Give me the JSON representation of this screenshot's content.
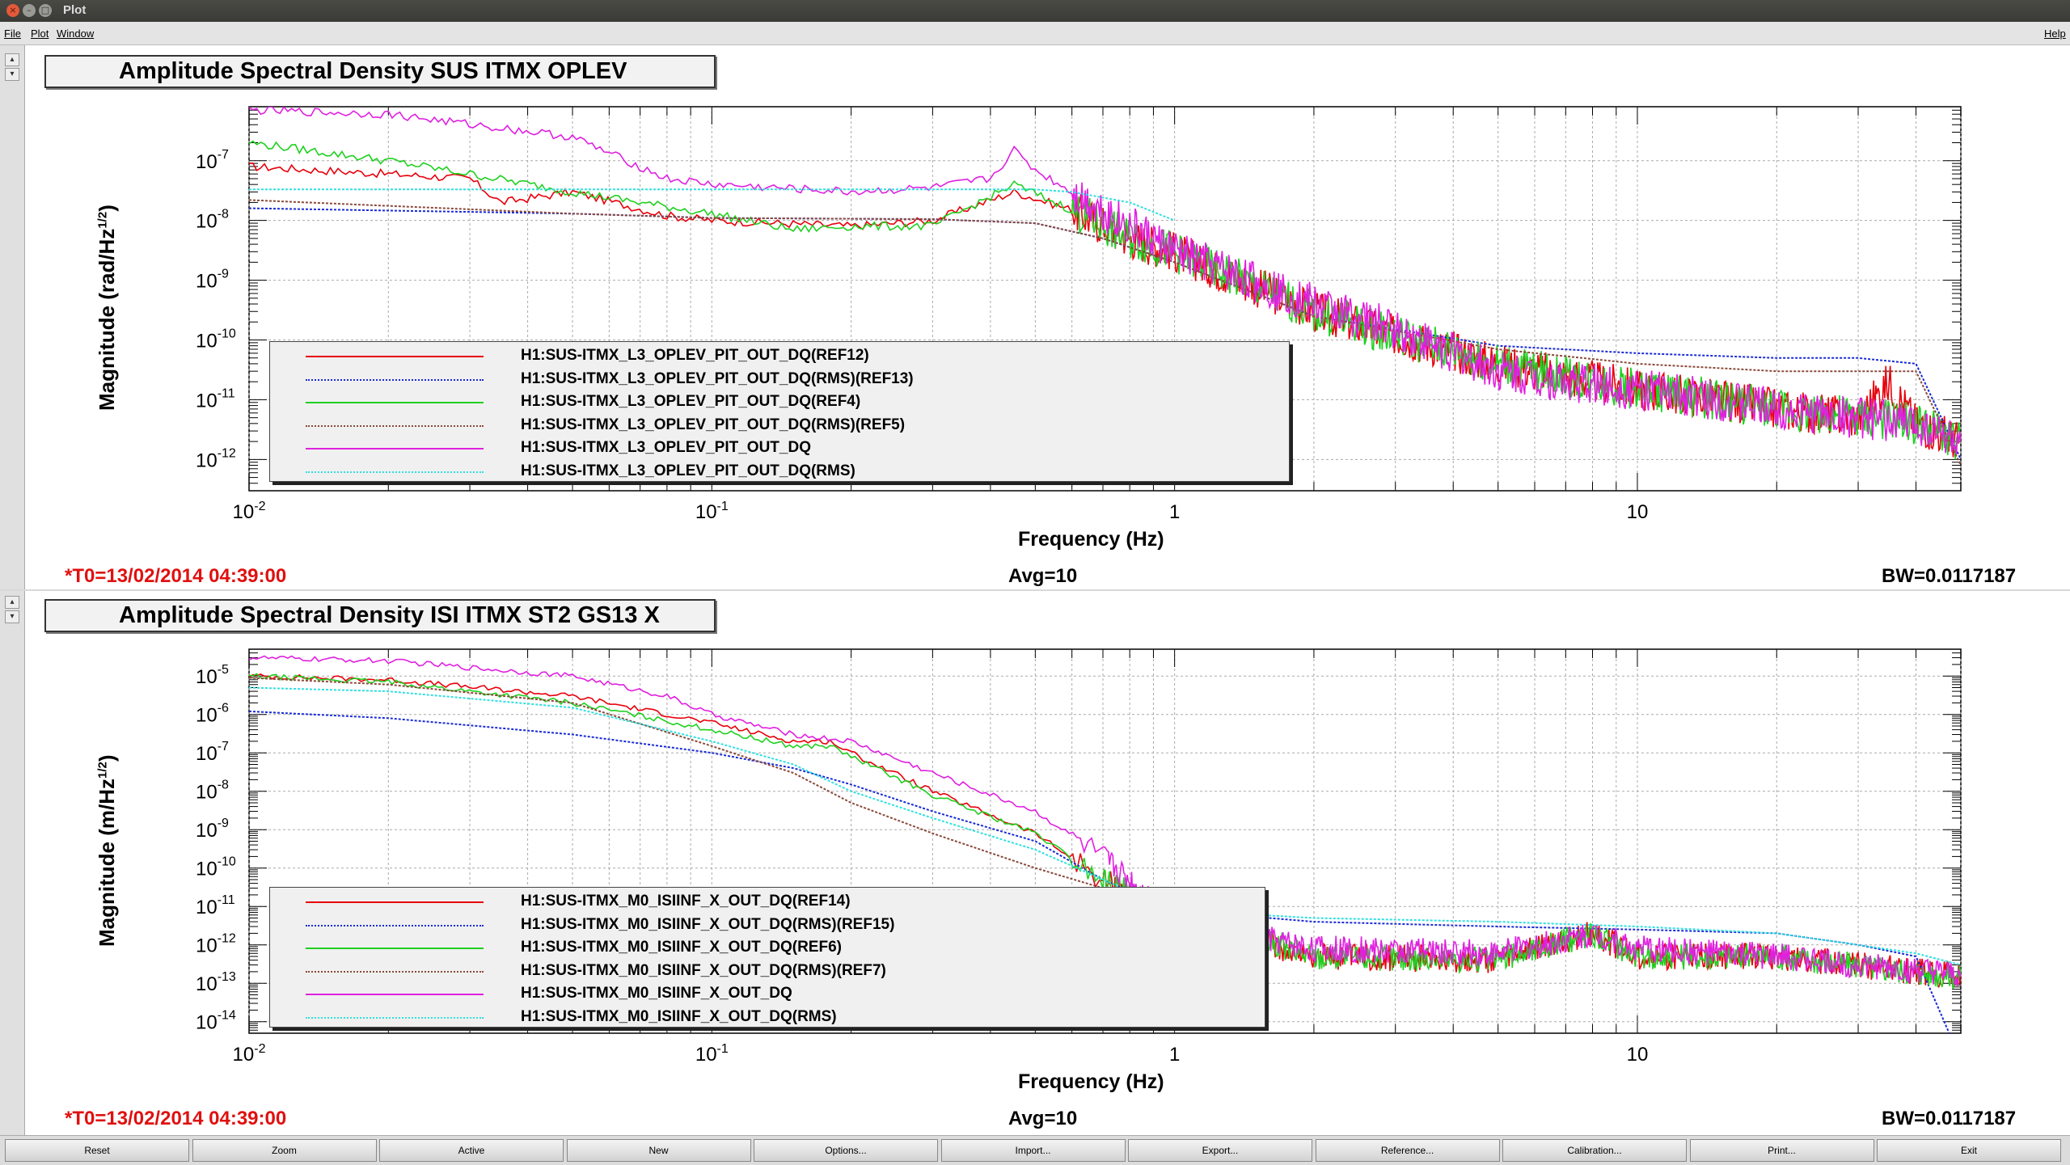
{
  "window": {
    "title": "Plot"
  },
  "menu": {
    "file": "File",
    "plot": "Plot",
    "window": "Window",
    "help": "Help"
  },
  "panels": [
    {
      "title": "Amplitude Spectral Density SUS ITMX OPLEV",
      "ylabel_main": "Magnitude (rad/Hz",
      "ylabel_sup": "1/2",
      "ylabel_end": ")",
      "xlabel": "Frequency (Hz)",
      "t0": "*T0=13/02/2014 04:39:00",
      "avg": "Avg=10",
      "bw": "BW=0.0117187",
      "legend": [
        {
          "label": "H1:SUS-ITMX_L3_OPLEV_PIT_OUT_DQ(REF12)",
          "color": "#e8000b",
          "dash": false
        },
        {
          "label": "H1:SUS-ITMX_L3_OPLEV_PIT_OUT_DQ(RMS)(REF13)",
          "color": "#1a2bd6",
          "dash": true
        },
        {
          "label": "H1:SUS-ITMX_L3_OPLEV_PIT_OUT_DQ(REF4)",
          "color": "#20d020",
          "dash": false
        },
        {
          "label": "H1:SUS-ITMX_L3_OPLEV_PIT_OUT_DQ(RMS)(REF5)",
          "color": "#8a4a3a",
          "dash": true
        },
        {
          "label": "H1:SUS-ITMX_L3_OPLEV_PIT_OUT_DQ",
          "color": "#e020e0",
          "dash": false
        },
        {
          "label": "H1:SUS-ITMX_L3_OPLEV_PIT_OUT_DQ(RMS)",
          "color": "#30e0e0",
          "dash": true
        }
      ]
    },
    {
      "title": "Amplitude Spectral Density ISI ITMX ST2 GS13 X",
      "ylabel_main": "Magnitude (m/Hz",
      "ylabel_sup": "1/2",
      "ylabel_end": ")",
      "xlabel": "Frequency (Hz)",
      "t0": "*T0=13/02/2014 04:39:00",
      "avg": "Avg=10",
      "bw": "BW=0.0117187",
      "legend": [
        {
          "label": "H1:SUS-ITMX_M0_ISIINF_X_OUT_DQ(REF14)",
          "color": "#e8000b",
          "dash": false
        },
        {
          "label": "H1:SUS-ITMX_M0_ISIINF_X_OUT_DQ(RMS)(REF15)",
          "color": "#1a2bd6",
          "dash": true
        },
        {
          "label": "H1:SUS-ITMX_M0_ISIINF_X_OUT_DQ(REF6)",
          "color": "#20d020",
          "dash": false
        },
        {
          "label": "H1:SUS-ITMX_M0_ISIINF_X_OUT_DQ(RMS)(REF7)",
          "color": "#8a4a3a",
          "dash": true
        },
        {
          "label": "H1:SUS-ITMX_M0_ISIINF_X_OUT_DQ",
          "color": "#e020e0",
          "dash": false
        },
        {
          "label": "H1:SUS-ITMX_M0_ISIINF_X_OUT_DQ(RMS)",
          "color": "#30e0e0",
          "dash": true
        }
      ]
    }
  ],
  "buttons": [
    "Reset",
    "Zoom",
    "Active",
    "New",
    "Options...",
    "Import...",
    "Export...",
    "Reference...",
    "Calibration...",
    "Print...",
    "Exit"
  ],
  "chart_data": [
    {
      "type": "line",
      "title": "Amplitude Spectral Density SUS ITMX OPLEV",
      "xlabel": "Frequency (Hz)",
      "ylabel": "Magnitude (rad/Hz^1/2)",
      "xscale": "log",
      "yscale": "log",
      "xlim": [
        0.01,
        50
      ],
      "ylim": [
        3e-13,
        8e-07
      ],
      "x_ticklabels": [
        "10^-2",
        "10^-1",
        "1",
        "10"
      ],
      "y_ticklabels": [
        "10^-12",
        "10^-11",
        "10^-10",
        "10^-9",
        "10^-8",
        "10^-7"
      ],
      "grid": true,
      "legend_position": "lower-left",
      "series": [
        {
          "name": "H1:SUS-ITMX_L3_OPLEV_PIT_OUT_DQ(REF12)",
          "x": [
            0.01,
            0.02,
            0.03,
            0.035,
            0.05,
            0.08,
            0.1,
            0.2,
            0.3,
            0.45,
            0.6,
            0.8,
            1,
            2,
            3,
            5,
            7,
            10,
            15,
            20,
            30,
            35,
            40,
            50
          ],
          "y": [
            8e-08,
            6e-08,
            5e-08,
            2e-08,
            3e-08,
            1.2e-08,
            1e-08,
            8e-09,
            1e-08,
            3e-08,
            1.5e-08,
            5e-09,
            3e-09,
            3e-10,
            1.2e-10,
            4e-11,
            2.5e-11,
            1.5e-11,
            1e-11,
            7e-12,
            5e-12,
            2e-11,
            4e-12,
            2e-12
          ]
        },
        {
          "name": "H1:SUS-ITMX_L3_OPLEV_PIT_OUT_DQ(RMS)(REF13)",
          "x": [
            0.01,
            0.05,
            0.1,
            0.3,
            0.5,
            0.7,
            1,
            2,
            5,
            10,
            20,
            30,
            40,
            50
          ],
          "y": [
            1.6e-08,
            1.3e-08,
            1.1e-08,
            1.05e-08,
            9e-09,
            5e-09,
            2e-09,
            2.5e-10,
            8e-11,
            6e-11,
            5e-11,
            5e-11,
            4e-11,
            1e-12
          ]
        },
        {
          "name": "H1:SUS-ITMX_L3_OPLEV_PIT_OUT_DQ(REF4)",
          "x": [
            0.01,
            0.02,
            0.03,
            0.05,
            0.1,
            0.15,
            0.2,
            0.3,
            0.45,
            0.6,
            0.8,
            1,
            2,
            3,
            5,
            7,
            10,
            15,
            20,
            30,
            40,
            50
          ],
          "y": [
            2e-07,
            1e-07,
            6e-08,
            3e-08,
            1.3e-08,
            7e-09,
            8e-09,
            8e-09,
            4e-08,
            1.5e-08,
            5e-09,
            3e-09,
            3e-10,
            1.2e-10,
            4e-11,
            2.5e-11,
            1.5e-11,
            1e-11,
            7e-12,
            5e-12,
            4e-12,
            2e-12
          ]
        },
        {
          "name": "H1:SUS-ITMX_L3_OPLEV_PIT_OUT_DQ(RMS)(REF5)",
          "x": [
            0.01,
            0.05,
            0.1,
            0.3,
            0.5,
            0.7,
            1,
            2,
            5,
            10,
            20,
            30,
            40,
            50
          ],
          "y": [
            2.2e-08,
            1.3e-08,
            1.1e-08,
            1.05e-08,
            9e-09,
            5e-09,
            2e-09,
            2.5e-10,
            7e-11,
            4e-11,
            3e-11,
            3e-11,
            3e-11,
            8e-13
          ]
        },
        {
          "name": "H1:SUS-ITMX_L3_OPLEV_PIT_OUT_DQ",
          "x": [
            0.01,
            0.02,
            0.05,
            0.08,
            0.1,
            0.2,
            0.3,
            0.4,
            0.45,
            0.5,
            0.6,
            0.8,
            1,
            2,
            3,
            5,
            7,
            10,
            15,
            20,
            30,
            40,
            50
          ],
          "y": [
            7e-07,
            6e-07,
            2.5e-07,
            5e-08,
            4e-08,
            3e-08,
            3.5e-08,
            5e-08,
            1.5e-07,
            7e-08,
            3e-08,
            8e-09,
            3e-09,
            4e-10,
            1.5e-10,
            3e-11,
            2e-11,
            1.5e-11,
            1e-11,
            7e-12,
            5e-12,
            4e-12,
            2e-12
          ]
        },
        {
          "name": "H1:SUS-ITMX_L3_OPLEV_PIT_OUT_DQ(RMS)",
          "x": [
            0.01,
            0.05,
            0.1,
            0.3,
            0.5,
            0.6,
            0.8,
            1
          ],
          "y": [
            3.3e-08,
            3.3e-08,
            3.3e-08,
            3.3e-08,
            3.3e-08,
            3e-08,
            2e-08,
            1e-08
          ]
        }
      ]
    },
    {
      "type": "line",
      "title": "Amplitude Spectral Density ISI ITMX ST2 GS13 X",
      "xlabel": "Frequency (Hz)",
      "ylabel": "Magnitude (m/Hz^1/2)",
      "xscale": "log",
      "yscale": "log",
      "xlim": [
        0.01,
        50
      ],
      "ylim": [
        5e-15,
        5e-05
      ],
      "x_ticklabels": [
        "10^-2",
        "10^-1",
        "1",
        "10"
      ],
      "y_ticklabels": [
        "10^-14",
        "10^-13",
        "10^-12",
        "10^-11",
        "10^-10",
        "10^-9",
        "10^-8",
        "10^-7",
        "10^-6",
        "10^-5"
      ],
      "grid": true,
      "legend_position": "lower-left",
      "series": [
        {
          "name": "H1:SUS-ITMX_M0_ISIINF_X_OUT_DQ(REF14)",
          "x": [
            0.01,
            0.02,
            0.05,
            0.1,
            0.15,
            0.18,
            0.2,
            0.3,
            0.5,
            0.7,
            1,
            2,
            5,
            8,
            10,
            15,
            20,
            30,
            50
          ],
          "y": [
            1e-05,
            8e-06,
            3e-06,
            6e-07,
            2e-07,
            2e-07,
            1e-07,
            1e-08,
            8e-10,
            5e-11,
            5e-12,
            5e-13,
            4e-13,
            2e-12,
            5e-13,
            5e-13,
            5e-13,
            3e-13,
            1.5e-13
          ]
        },
        {
          "name": "H1:SUS-ITMX_M0_ISIINF_X_OUT_DQ(RMS)(REF15)",
          "x": [
            0.01,
            0.02,
            0.05,
            0.1,
            0.15,
            0.2,
            0.3,
            0.5,
            0.7,
            1,
            2,
            5,
            10,
            20,
            30,
            40,
            50
          ],
          "y": [
            1.2e-06,
            8e-07,
            3e-07,
            1e-07,
            4e-08,
            1.5e-08,
            3e-09,
            5e-10,
            5e-11,
            8e-12,
            4e-12,
            3e-12,
            2.5e-12,
            2e-12,
            1e-12,
            5e-13,
            1e-15
          ]
        },
        {
          "name": "H1:SUS-ITMX_M0_ISIINF_X_OUT_DQ(REF6)",
          "x": [
            0.01,
            0.02,
            0.05,
            0.1,
            0.15,
            0.18,
            0.2,
            0.3,
            0.5,
            0.7,
            1,
            2,
            5,
            8,
            10,
            15,
            20,
            30,
            50
          ],
          "y": [
            1e-05,
            7e-06,
            2e-06,
            4e-07,
            1.5e-07,
            1.5e-07,
            8e-08,
            8e-09,
            8e-10,
            5e-11,
            5e-12,
            5e-13,
            4e-13,
            2e-12,
            5e-13,
            5e-13,
            5e-13,
            3e-13,
            1.5e-13
          ]
        },
        {
          "name": "H1:SUS-ITMX_M0_ISIINF_X_OUT_DQ(RMS)(REF7)",
          "x": [
            0.01,
            0.02,
            0.05,
            0.1,
            0.15,
            0.2,
            0.3,
            0.5,
            0.7,
            1
          ],
          "y": [
            9e-06,
            6e-06,
            2e-06,
            1.5e-07,
            3e-08,
            5e-09,
            8e-10,
            1e-10,
            3e-11,
            1e-11
          ]
        },
        {
          "name": "H1:SUS-ITMX_M0_ISIINF_X_OUT_DQ",
          "x": [
            0.01,
            0.02,
            0.05,
            0.08,
            0.1,
            0.15,
            0.2,
            0.3,
            0.5,
            0.7,
            1,
            2,
            5,
            8,
            10,
            15,
            20,
            30,
            50
          ],
          "y": [
            3e-05,
            2.5e-05,
            1e-05,
            3e-06,
            1e-06,
            3e-07,
            2e-07,
            3e-08,
            3e-09,
            2e-10,
            5e-12,
            8e-13,
            6e-13,
            2e-12,
            8e-13,
            6e-13,
            5e-13,
            3e-13,
            1.5e-13
          ]
        },
        {
          "name": "H1:SUS-ITMX_M0_ISIINF_X_OUT_DQ(RMS)",
          "x": [
            0.01,
            0.02,
            0.05,
            0.1,
            0.15,
            0.2,
            0.3,
            0.5,
            0.7,
            1,
            2,
            5,
            10,
            20,
            30,
            40,
            50
          ],
          "y": [
            5e-06,
            4e-06,
            1.5e-06,
            2e-07,
            5e-08,
            1e-08,
            2e-09,
            3e-10,
            5e-11,
            8e-12,
            5e-12,
            4e-12,
            3e-12,
            2e-12,
            1e-12,
            6e-13,
            3e-13
          ]
        }
      ]
    }
  ]
}
